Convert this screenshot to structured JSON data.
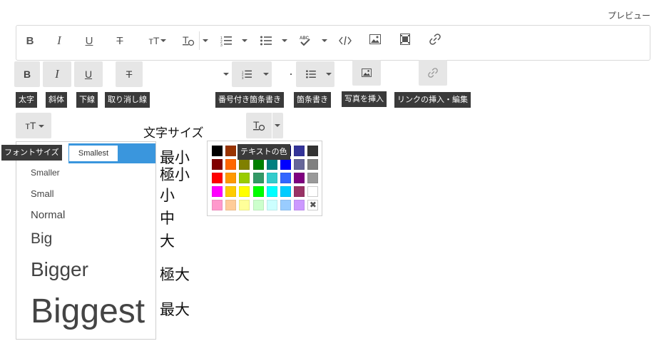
{
  "header": {
    "preview_link": "プレビュー"
  },
  "toolbar_icons": [
    "bold-icon",
    "italic-icon",
    "underline-icon",
    "strikethrough-icon",
    "font-size-icon",
    "text-color-icon",
    "numbered-list-icon",
    "bullet-list-icon",
    "spellcheck-icon",
    "code-icon",
    "image-icon",
    "video-icon",
    "link-icon"
  ],
  "buttons": {
    "bold": "B",
    "italic": "I",
    "underline": "U",
    "strike": "T",
    "fontsize": "тT",
    "numbered": "1≡",
    "bullet": "≡"
  },
  "tooltips": {
    "bold": "太字",
    "italic": "斜体",
    "underline": "下線",
    "strike": "取り消し線",
    "numbered": "番号付き箇条書き",
    "bullet": "箇条書き",
    "image": "写真を挿入",
    "link": "リンクの挿入・編集",
    "fontsize": "フォントサイズ",
    "textcolor": "テキストの色"
  },
  "labels": {
    "font_size_heading": "文字サイズ"
  },
  "font_sizes": [
    {
      "label": "Smallest",
      "jp": "最小",
      "selected": true
    },
    {
      "label": "Smaller",
      "jp": "極小"
    },
    {
      "label": "Small",
      "jp": "小"
    },
    {
      "label": "Normal",
      "jp": "中"
    },
    {
      "label": "Big",
      "jp": "大"
    },
    {
      "label": "Bigger",
      "jp": "極大"
    },
    {
      "label": "Biggest",
      "jp": "最大"
    }
  ],
  "colors": {
    "accent": "#3a96dd",
    "swatches": [
      [
        "#000000",
        "#993300",
        "#333300",
        "#003300",
        "#003366",
        "#000080",
        "#333399",
        "#333333"
      ],
      [
        "#800000",
        "#ff6600",
        "#808000",
        "#008000",
        "#008080",
        "#0000ff",
        "#666699",
        "#808080"
      ],
      [
        "#ff0000",
        "#ff9900",
        "#99cc00",
        "#339966",
        "#33cccc",
        "#3366ff",
        "#800080",
        "#999999"
      ],
      [
        "#ff00ff",
        "#ffcc00",
        "#ffff00",
        "#00ff00",
        "#00ffff",
        "#00ccff",
        "#993366",
        "#ffffff"
      ],
      [
        "#ff99cc",
        "#ffcc99",
        "#ffff99",
        "#ccffcc",
        "#ccffff",
        "#99ccff",
        "#cc99ff",
        "remove"
      ]
    ]
  }
}
